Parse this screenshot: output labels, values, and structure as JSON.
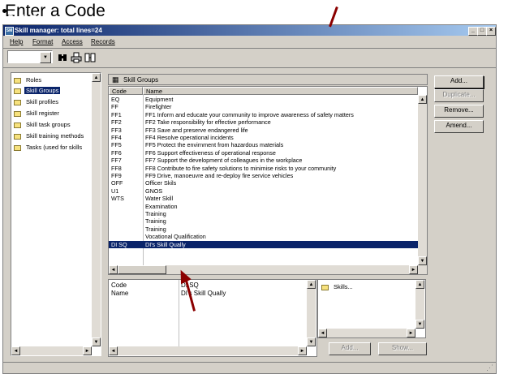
{
  "slide": {
    "title": "Enter a Code",
    "overlay_text": "Skill Groups"
  },
  "window": {
    "title": "Skill manager: total lines=24",
    "icon": "SM",
    "controls": {
      "minimize": "_",
      "maximize": "□",
      "close": "×"
    }
  },
  "menu": [
    "Help",
    "Format",
    "Access",
    "Records"
  ],
  "toolbar": {
    "combo_value": "",
    "combo_arrow": "▼",
    "icons": [
      "binoculars-icon",
      "printer-icon",
      "export-icon"
    ]
  },
  "tree": {
    "items": [
      {
        "label": "Roles",
        "selected": false
      },
      {
        "label": "Skill Groups",
        "selected": true
      },
      {
        "label": "Skill profiles",
        "selected": false
      },
      {
        "label": "Skill register",
        "selected": false
      },
      {
        "label": "Skill task groups",
        "selected": false
      },
      {
        "label": "Skill training methods",
        "selected": false
      },
      {
        "label": "Tasks (used for skills",
        "selected": false
      }
    ]
  },
  "grid": {
    "header": "Skill Groups",
    "columns": [
      "Code",
      "Name"
    ],
    "rows": [
      {
        "code": "EQ",
        "name": "Equipment"
      },
      {
        "code": "FF",
        "name": "Firefighter"
      },
      {
        "code": "FF1",
        "name": "FF1 Inform and educate your community to improve awareness of safety matters"
      },
      {
        "code": "FF2",
        "name": "FF2 Take responsibility for effective performance"
      },
      {
        "code": "FF3",
        "name": "FF3 Save and preserve endangered life"
      },
      {
        "code": "FF4",
        "name": "FF4 Resolve operational incidents"
      },
      {
        "code": "FF5",
        "name": "FF5 Protect the envirnment from hazardous materials"
      },
      {
        "code": "FF6",
        "name": "FF6 Support effectiveness of operational response"
      },
      {
        "code": "FF7",
        "name": "FF7 Support the development of colleagues in the workplace"
      },
      {
        "code": "FF8",
        "name": "FF8 Contribute to fire safety solutions to minimise risks to your community"
      },
      {
        "code": "FF9",
        "name": "FF9 Drive, manoeuvre and re-deploy fire service vehicles"
      },
      {
        "code": "OFF",
        "name": "Officer Skils"
      },
      {
        "code": "U1",
        "name": "GNOS"
      },
      {
        "code": "WTS",
        "name": "Water Skill"
      },
      {
        "code": "",
        "name": "Examination"
      },
      {
        "code": "",
        "name": "Training"
      },
      {
        "code": "",
        "name": "Training"
      },
      {
        "code": "",
        "name": "Training"
      },
      {
        "code": "",
        "name": "Vocational Qualification"
      },
      {
        "code": "DI SQ",
        "name": "DI's Skill Qually",
        "selected": true
      }
    ]
  },
  "buttons": {
    "add": "Add...",
    "duplicate": "Duplicate...",
    "remove": "Remove...",
    "amend": "Amend...",
    "detail_add": "Add...",
    "detail_show": "Show..."
  },
  "detail": {
    "code_label": "Code",
    "name_label": "Name",
    "code_value": "DI SQ",
    "name_value": "DI's Skill Qually"
  },
  "skills_pane": {
    "label": "Skills..."
  },
  "colors": {
    "selection": "#0a246a",
    "face": "#d4d0c8",
    "annotation": "#8b0000"
  }
}
